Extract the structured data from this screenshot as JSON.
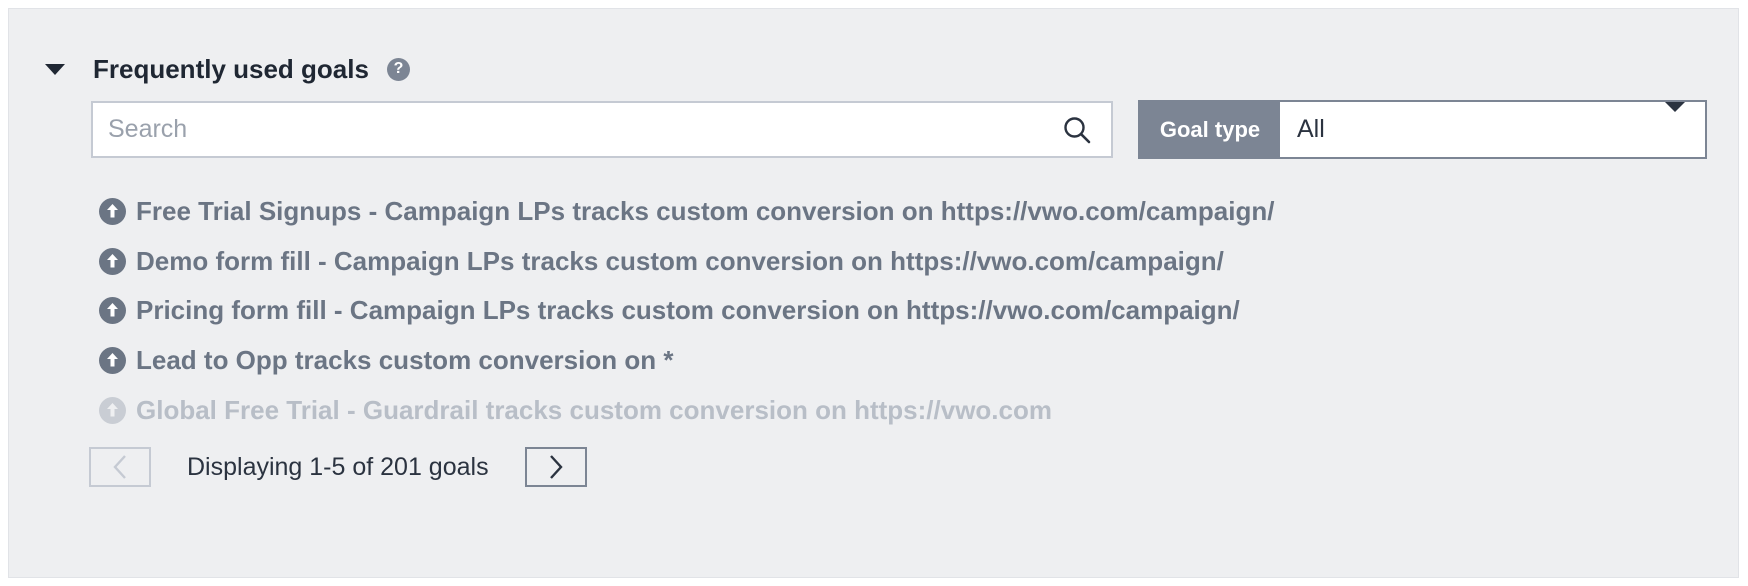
{
  "section": {
    "title": "Frequently used goals",
    "help_glyph": "?"
  },
  "search": {
    "placeholder": "Search"
  },
  "goal_type": {
    "label": "Goal type",
    "selected": "All"
  },
  "goals": [
    {
      "text": "Free Trial Signups - Campaign LPs tracks custom conversion on https://vwo.com/campaign/",
      "faded": false
    },
    {
      "text": "Demo form fill - Campaign LPs tracks custom conversion on https://vwo.com/campaign/",
      "faded": false
    },
    {
      "text": "Pricing form fill - Campaign LPs tracks custom conversion on https://vwo.com/campaign/",
      "faded": false
    },
    {
      "text": "Lead to Opp tracks custom conversion on *",
      "faded": false
    },
    {
      "text": "Global Free Trial - Guardrail tracks custom conversion on https://vwo.com",
      "faded": true
    }
  ],
  "pagination": {
    "text": "Displaying 1-5 of 201 goals",
    "prev_enabled": false,
    "next_enabled": true
  },
  "colors": {
    "panel_bg": "#eeeff1",
    "accent_gray": "#7c8594",
    "goal_text": "#6b7584",
    "goal_text_faded": "#b8bec7"
  },
  "icons": {
    "collapse": "caret-down-icon",
    "help": "help-circle-icon",
    "search": "search-icon",
    "dropdown": "chevron-down-icon",
    "goal": "arrow-up-circle-icon",
    "prev": "chevron-left-icon",
    "next": "chevron-right-icon"
  }
}
